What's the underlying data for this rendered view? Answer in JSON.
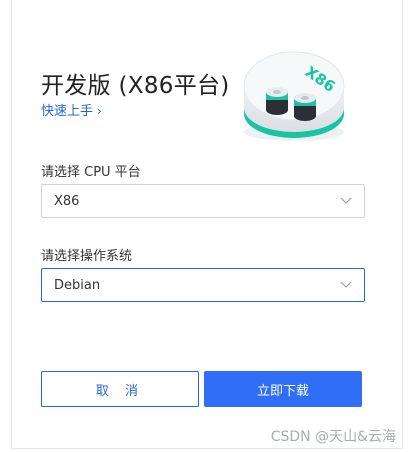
{
  "title": "开发版 (X86平台)",
  "quick_start": {
    "label": "快速上手",
    "chevron": "›"
  },
  "illustration": {
    "badge_text": "X86"
  },
  "cpu": {
    "label": "请选择 CPU 平台",
    "selected": "X86"
  },
  "os": {
    "label": "请选择操作系统",
    "selected": "Debian"
  },
  "buttons": {
    "cancel": "取 消",
    "download": "立即下载"
  },
  "watermark": "CSDN @天山&云海",
  "colors": {
    "accent": "#2f6ef5",
    "teal": "#19c4a0"
  }
}
